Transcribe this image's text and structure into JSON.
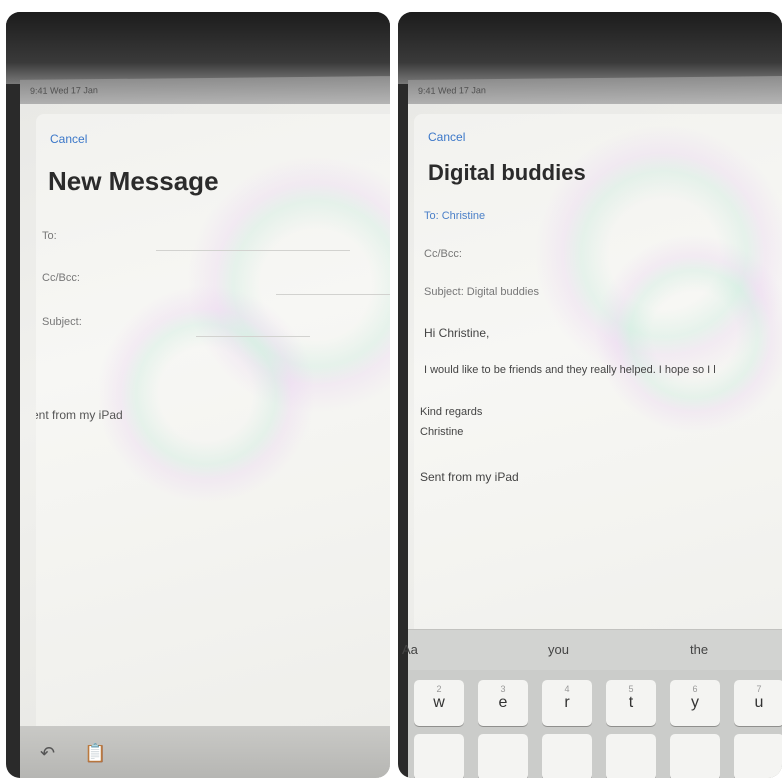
{
  "left": {
    "status_text": "9:41  Wed 17 Jan",
    "cancel_label": "Cancel",
    "title": "New Message",
    "fields": [
      {
        "label": "To:"
      },
      {
        "label": "Cc/Bcc:"
      },
      {
        "label": "Subject:"
      }
    ],
    "signature": "Sent from my iPad",
    "toolbar": {
      "undo_icon": "undo-icon",
      "paste_icon": "clipboard-icon"
    }
  },
  "right": {
    "status_text": "9:41  Wed 17 Jan",
    "cancel_label": "Cancel",
    "title": "Digital buddies",
    "to_line": "To: Christine",
    "cc_line": "Cc/Bcc:",
    "subject_line": "Subject: Digital buddies",
    "greeting": "Hi Christine,",
    "body": "I would like to be friends and they really helped. I hope so I l",
    "closing": "Kind regards",
    "sign_name": "Christine",
    "signature": "Sent from my iPad",
    "suggestions": {
      "format": "Aa",
      "s1": "you",
      "s2": "the"
    },
    "keys": [
      {
        "letter": "w",
        "num": "2"
      },
      {
        "letter": "e",
        "num": "3"
      },
      {
        "letter": "r",
        "num": "4"
      },
      {
        "letter": "t",
        "num": "5"
      },
      {
        "letter": "y",
        "num": "6"
      },
      {
        "letter": "u",
        "num": "7"
      }
    ]
  }
}
